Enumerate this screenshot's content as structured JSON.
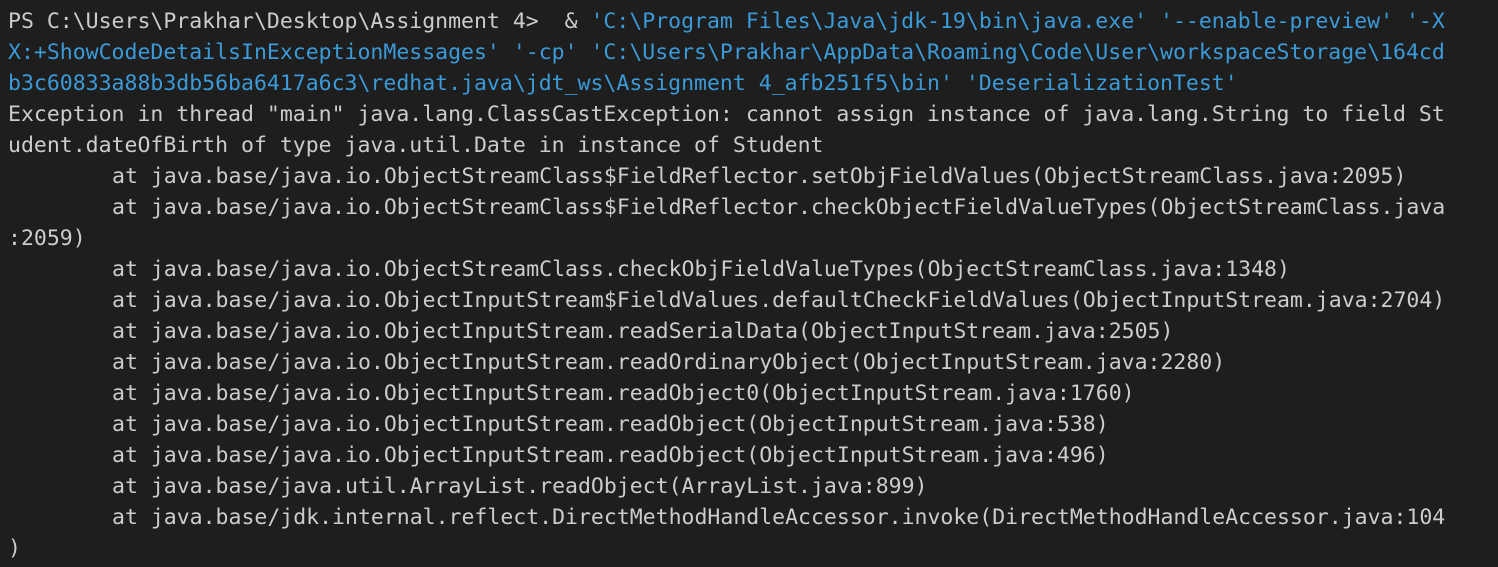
{
  "terminal": {
    "prompt": "PS C:\\Users\\Prakhar\\Desktop\\Assignment 4> ",
    "command_amp": " &",
    "command_lines": [
      " 'C:\\Program Files\\Java\\jdk-19\\bin\\java.exe' '--enable-preview' '-X",
      "X:+ShowCodeDetailsInExceptionMessages' '-cp' 'C:\\Users\\Prakhar\\AppData\\Roaming\\Code\\User\\workspaceStorage\\164cd",
      "b3c60833a88b3db56ba6417a6c3\\redhat.java\\jdt_ws\\Assignment 4_afb251f5\\bin' 'DeserializationTest'"
    ],
    "exception_lines": [
      "Exception in thread \"main\" java.lang.ClassCastException: cannot assign instance of java.lang.String to field St",
      "udent.dateOfBirth of type java.util.Date in instance of Student"
    ],
    "stack": [
      "at java.base/java.io.ObjectStreamClass$FieldReflector.setObjFieldValues(ObjectStreamClass.java:2095)",
      "at java.base/java.io.ObjectStreamClass$FieldReflector.checkObjectFieldValueTypes(ObjectStreamClass.java",
      ":2059)",
      "at java.base/java.io.ObjectStreamClass.checkObjFieldValueTypes(ObjectStreamClass.java:1348)",
      "at java.base/java.io.ObjectInputStream$FieldValues.defaultCheckFieldValues(ObjectInputStream.java:2704)",
      "at java.base/java.io.ObjectInputStream.readSerialData(ObjectInputStream.java:2505)",
      "at java.base/java.io.ObjectInputStream.readOrdinaryObject(ObjectInputStream.java:2280)",
      "at java.base/java.io.ObjectInputStream.readObject0(ObjectInputStream.java:1760)",
      "at java.base/java.io.ObjectInputStream.readObject(ObjectInputStream.java:538)",
      "at java.base/java.io.ObjectInputStream.readObject(ObjectInputStream.java:496)",
      "at java.base/java.util.ArrayList.readObject(ArrayList.java:899)",
      "at java.base/jdk.internal.reflect.DirectMethodHandleAccessor.invoke(DirectMethodHandleAccessor.java:104",
      ")"
    ]
  },
  "colors": {
    "background": "#1e1e1e",
    "default_text": "#cccccc",
    "command_arg": "#3b9ad8"
  }
}
